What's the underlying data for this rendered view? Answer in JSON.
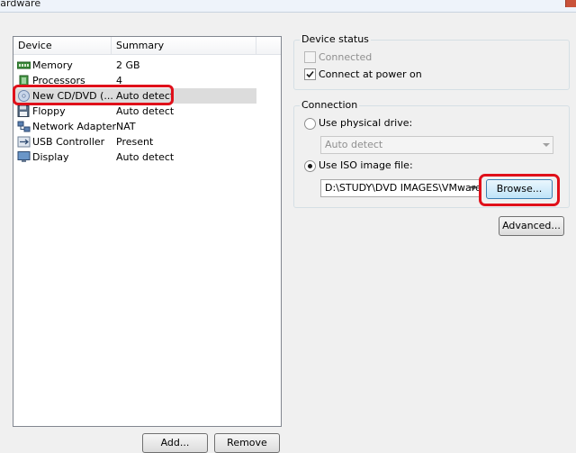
{
  "window": {
    "title": "Hardware"
  },
  "device_list": {
    "columns": [
      "Device",
      "Summary"
    ],
    "rows": [
      {
        "device": "Memory",
        "summary": "2 GB",
        "icon": "memory-icon"
      },
      {
        "device": "Processors",
        "summary": "4",
        "icon": "processor-icon"
      },
      {
        "device": "New CD/DVD (...",
        "summary": "Auto detect",
        "icon": "cd-dvd-icon",
        "selected": true
      },
      {
        "device": "Floppy",
        "summary": "Auto detect",
        "icon": "floppy-icon"
      },
      {
        "device": "Network Adapter",
        "summary": "NAT",
        "icon": "network-adapter-icon"
      },
      {
        "device": "USB Controller",
        "summary": "Present",
        "icon": "usb-controller-icon"
      },
      {
        "device": "Display",
        "summary": "Auto detect",
        "icon": "display-icon"
      }
    ]
  },
  "buttons": {
    "add": "Add...",
    "remove": "Remove"
  },
  "device_status": {
    "label": "Device status",
    "connected": {
      "label": "Connected",
      "checked": false,
      "enabled": false
    },
    "connect_at_power_on": {
      "label": "Connect at power on",
      "checked": true,
      "enabled": true
    }
  },
  "connection": {
    "label": "Connection",
    "use_physical_drive": {
      "label": "Use physical drive:",
      "selected": false
    },
    "physical_drive_value": "Auto detect",
    "use_iso": {
      "label": "Use ISO image file:",
      "selected": true
    },
    "iso_path": "D:\\STUDY\\DVD IMAGES\\VMware",
    "browse": "Browse...",
    "advanced": "Advanced..."
  },
  "colors": {
    "annotation": "#e0101a",
    "selection": "#dcdcdc",
    "browse_focus": "#bfe4f8"
  }
}
